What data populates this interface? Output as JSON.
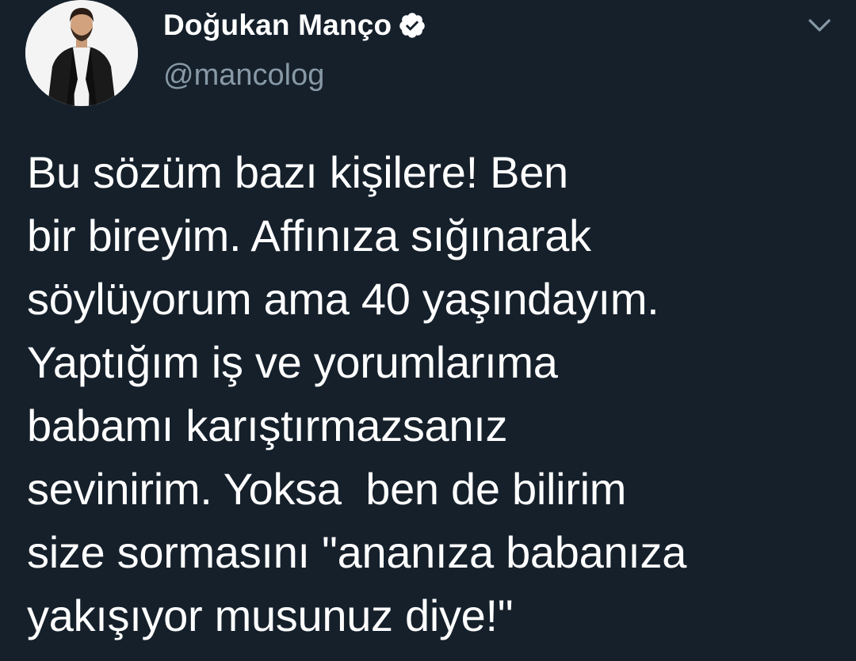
{
  "header": {
    "display_name": "Doğukan Manço",
    "handle": "@mancolog",
    "verified_icon": "verified-badge-icon",
    "menu_icon": "chevron-down-icon"
  },
  "tweet": {
    "lines": [
      "Bu sözüm bazı kişilere! Ben",
      "bir bireyim. Affınıza sığınarak",
      "söylüyorum ama 40 yaşındayım.",
      "Yaptığım iş ve yorumlarıma",
      "babamı karıştırmazsanız",
      "sevinirim. Yoksa  ben de bilirim",
      "size sormasını \"ananıza babanıza",
      "yakışıyor musunuz diye!\""
    ]
  },
  "colors": {
    "background": "#15202b",
    "text": "#ffffff",
    "secondary_text": "#8899a6"
  }
}
